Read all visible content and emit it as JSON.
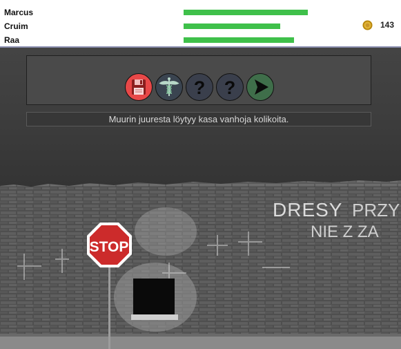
{
  "party": {
    "members": [
      {
        "name": "Marcus",
        "health": 0.9
      },
      {
        "name": "Cruim",
        "health": 0.7
      },
      {
        "name": "Raa",
        "health": 0.8
      }
    ],
    "gold": "143"
  },
  "actions": [
    {
      "icon": "floppy-disk-icon"
    },
    {
      "icon": "caduceus-icon"
    },
    {
      "icon": "question-mark-icon"
    },
    {
      "icon": "question-mark-icon"
    },
    {
      "icon": "play-arrow-icon"
    }
  ],
  "message": "Muurin juuresta löytyy kasa vanhoja kolikoita.",
  "scene": {
    "sign_text": "STOP",
    "graffiti_1": "DRESY",
    "graffiti_2": "PRZY",
    "graffiti_3": "NIE Z ZA"
  },
  "colors": {
    "health": "#3fc04a",
    "save_button": "#e84848",
    "heal_button": "#3a4450",
    "help_button": "#3a3f4c",
    "next_button": "#3f6e4a"
  }
}
